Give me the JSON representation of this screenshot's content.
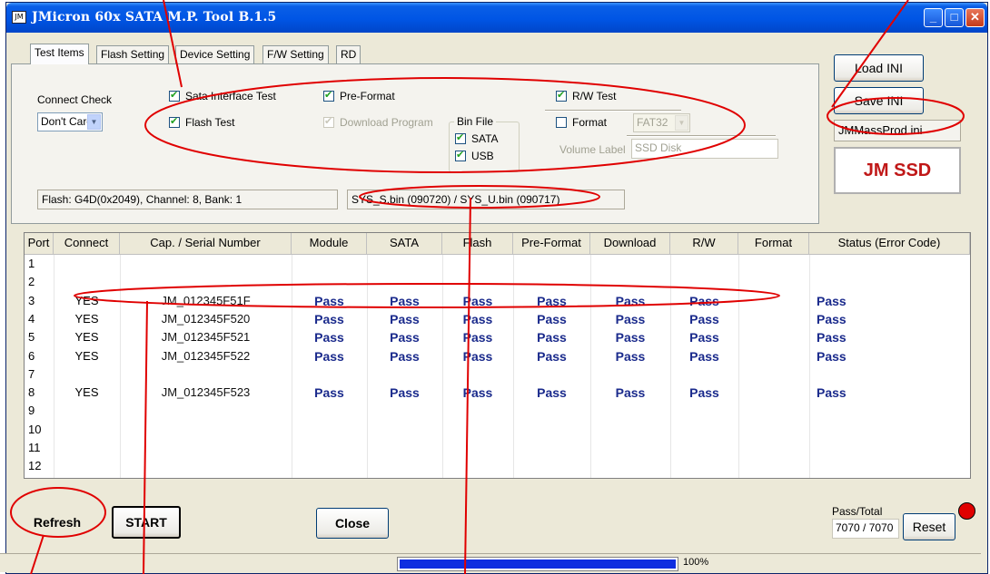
{
  "window": {
    "title": "JMicron 60x SATA M.P. Tool B.1.5",
    "icon": "app-icon"
  },
  "tabs": [
    {
      "label": "Test Items",
      "active": true
    },
    {
      "label": "Flash Setting",
      "active": false
    },
    {
      "label": "Device Setting",
      "active": false
    },
    {
      "label": "F/W Setting",
      "active": false
    },
    {
      "label": "RD",
      "active": false
    }
  ],
  "test_items": {
    "connect_check_label": "Connect Check",
    "connect_check_value": "Don't Care",
    "sata_interface_test": {
      "label": "Sata Interface Test",
      "checked": true
    },
    "flash_test": {
      "label": "Flash Test",
      "checked": true
    },
    "pre_format": {
      "label": "Pre-Format",
      "checked": true
    },
    "download_program": {
      "label": "Download Program",
      "checked": true,
      "disabled": true
    },
    "bin_file": {
      "label": "Bin File",
      "sata": {
        "label": "SATA",
        "checked": true
      },
      "usb": {
        "label": "USB",
        "checked": true
      }
    },
    "rw_test": {
      "label": "R/W Test",
      "checked": true
    },
    "format": {
      "label": "Format",
      "checked": false
    },
    "format_fs": "FAT32",
    "volume_label_label": "Volume Label",
    "volume_label_value": "SSD Disk",
    "flash_info": "Flash: G4D(0x2049), Channel: 8, Bank: 1",
    "bin_info": "SYS_S.bin (090720)  / SYS_U.bin (090717)"
  },
  "right_panel": {
    "load_ini": "Load INI",
    "save_ini": "Save INI",
    "ini_file": "JMMassProd.ini",
    "logo": "JM SSD"
  },
  "grid": {
    "columns": [
      "Port",
      "Connect",
      "Cap. / Serial Number",
      "Module",
      "SATA",
      "Flash",
      "Pre-Format",
      "Download",
      "R/W",
      "Format",
      "Status (Error Code)"
    ],
    "rows": [
      {
        "port": "1",
        "connect": "",
        "serial": "",
        "module": "",
        "sata": "",
        "flash": "",
        "preformat": "",
        "download": "",
        "rw": "",
        "format": "",
        "status": ""
      },
      {
        "port": "2",
        "connect": "",
        "serial": "",
        "module": "",
        "sata": "",
        "flash": "",
        "preformat": "",
        "download": "",
        "rw": "",
        "format": "",
        "status": ""
      },
      {
        "port": "3",
        "connect": "YES",
        "serial": "JM_012345F51F",
        "module": "Pass",
        "sata": "Pass",
        "flash": "Pass",
        "preformat": "Pass",
        "download": "Pass",
        "rw": "Pass",
        "format": "",
        "status": "Pass"
      },
      {
        "port": "4",
        "connect": "YES",
        "serial": "JM_012345F520",
        "module": "Pass",
        "sata": "Pass",
        "flash": "Pass",
        "preformat": "Pass",
        "download": "Pass",
        "rw": "Pass",
        "format": "",
        "status": "Pass"
      },
      {
        "port": "5",
        "connect": "YES",
        "serial": "JM_012345F521",
        "module": "Pass",
        "sata": "Pass",
        "flash": "Pass",
        "preformat": "Pass",
        "download": "Pass",
        "rw": "Pass",
        "format": "",
        "status": "Pass"
      },
      {
        "port": "6",
        "connect": "YES",
        "serial": "JM_012345F522",
        "module": "Pass",
        "sata": "Pass",
        "flash": "Pass",
        "preformat": "Pass",
        "download": "Pass",
        "rw": "Pass",
        "format": "",
        "status": "Pass"
      },
      {
        "port": "7",
        "connect": "",
        "serial": "",
        "module": "",
        "sata": "",
        "flash": "",
        "preformat": "",
        "download": "",
        "rw": "",
        "format": "",
        "status": ""
      },
      {
        "port": "8",
        "connect": "YES",
        "serial": "JM_012345F523",
        "module": "Pass",
        "sata": "Pass",
        "flash": "Pass",
        "preformat": "Pass",
        "download": "Pass",
        "rw": "Pass",
        "format": "",
        "status": "Pass"
      },
      {
        "port": "9",
        "connect": "",
        "serial": "",
        "module": "",
        "sata": "",
        "flash": "",
        "preformat": "",
        "download": "",
        "rw": "",
        "format": "",
        "status": ""
      },
      {
        "port": "10",
        "connect": "",
        "serial": "",
        "module": "",
        "sata": "",
        "flash": "",
        "preformat": "",
        "download": "",
        "rw": "",
        "format": "",
        "status": ""
      },
      {
        "port": "11",
        "connect": "",
        "serial": "",
        "module": "",
        "sata": "",
        "flash": "",
        "preformat": "",
        "download": "",
        "rw": "",
        "format": "",
        "status": ""
      },
      {
        "port": "12",
        "connect": "",
        "serial": "",
        "module": "",
        "sata": "",
        "flash": "",
        "preformat": "",
        "download": "",
        "rw": "",
        "format": "",
        "status": ""
      }
    ]
  },
  "bottom": {
    "refresh": "Refresh",
    "start": "START",
    "close": "Close",
    "pass_total_label": "Pass/Total",
    "pass_total_value": "7070 / 7070",
    "reset": "Reset",
    "status_led_color": "#e00000"
  },
  "statusbar": {
    "progress": 1.0,
    "progress_text": "100%",
    "progress_color": "#0f2ee0"
  },
  "annotation_color": "#e00000"
}
